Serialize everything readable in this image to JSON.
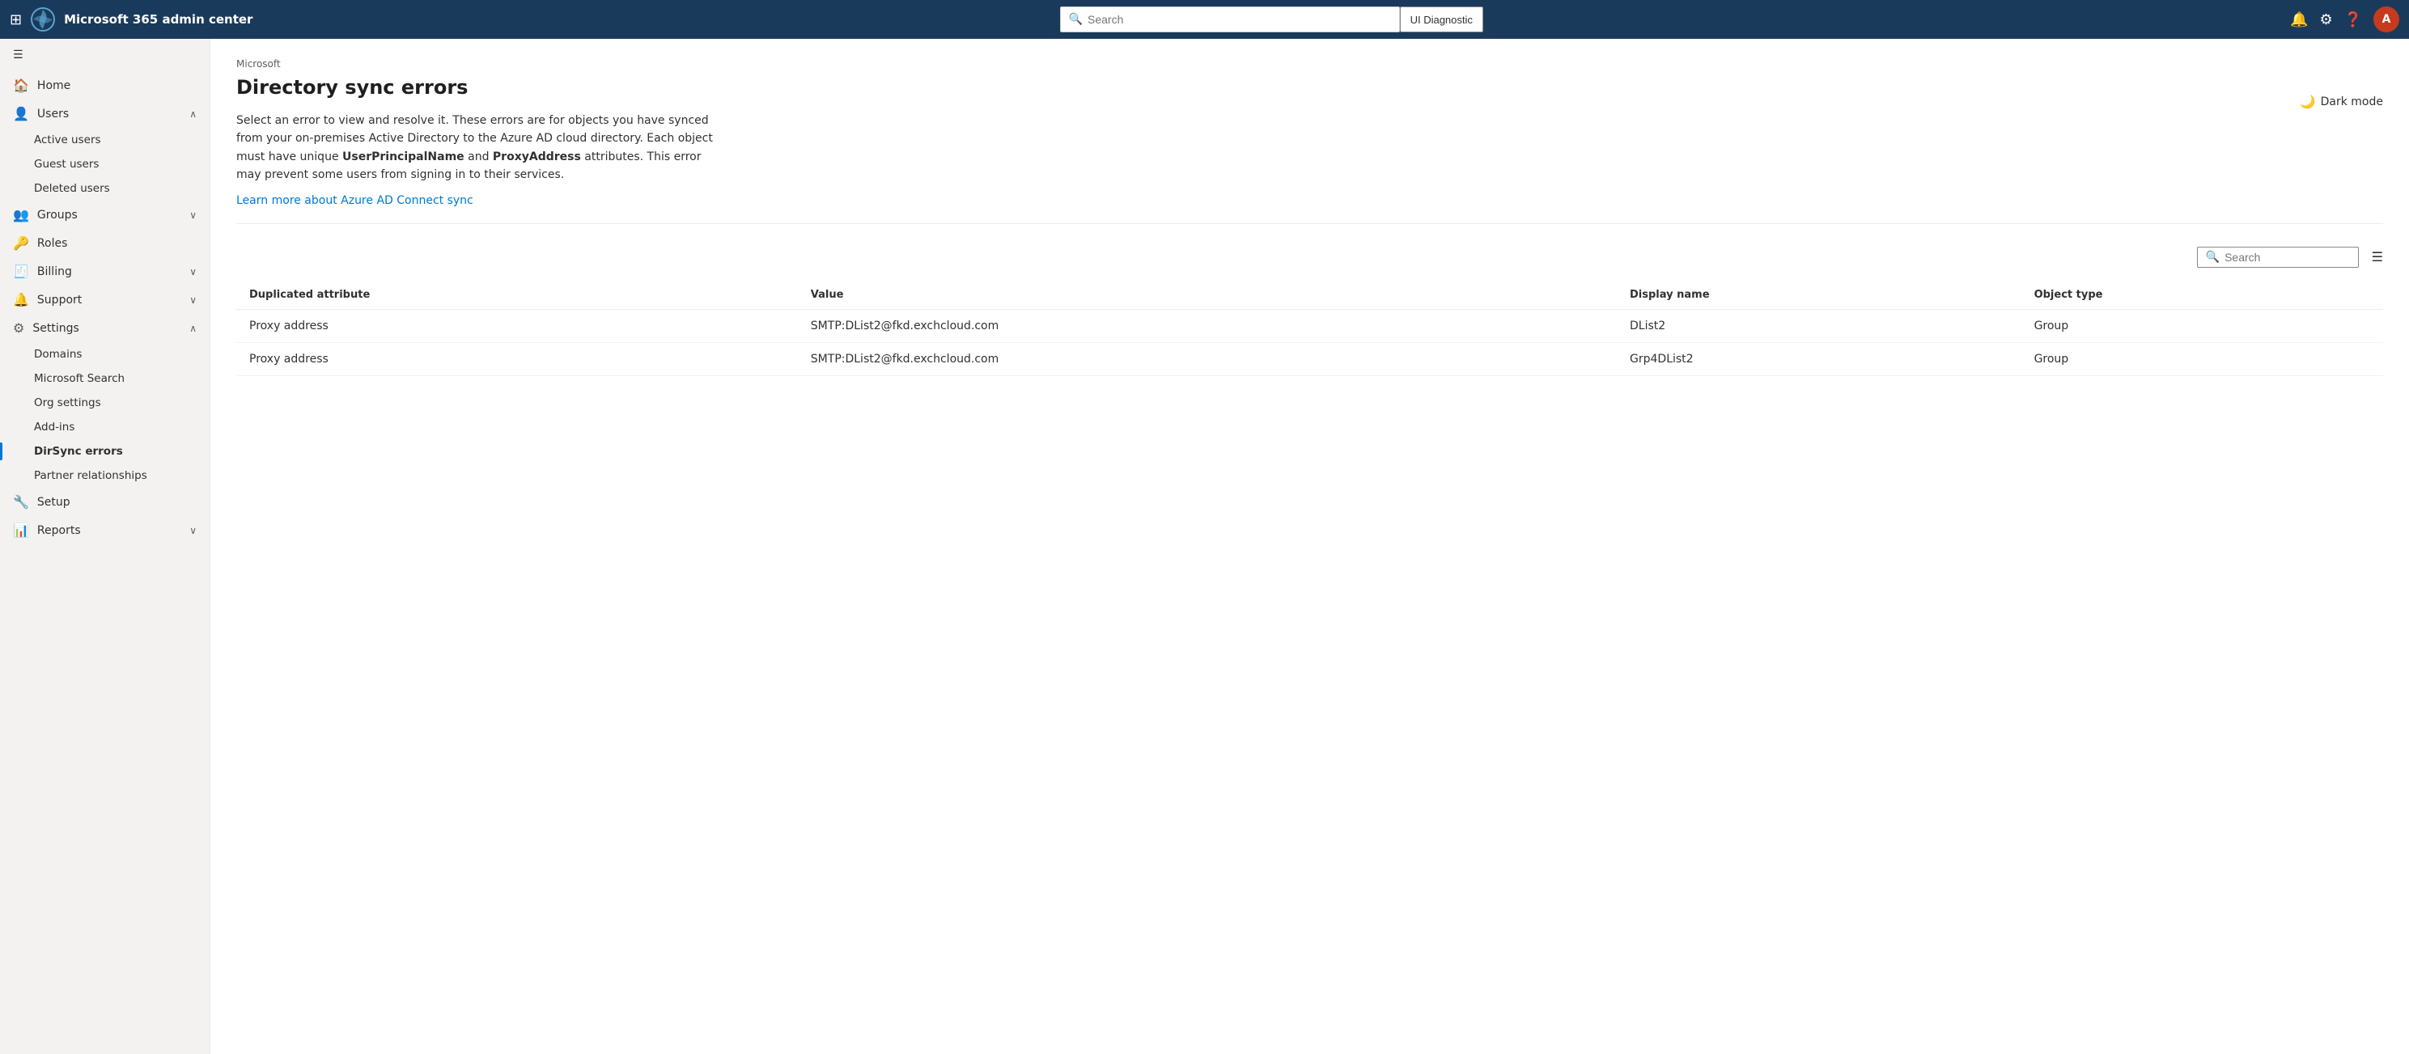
{
  "topbar": {
    "title": "Microsoft 365 admin center",
    "search_placeholder": "Search",
    "ui_diagnostic_label": "UI Diagnostic",
    "avatar_initials": "A"
  },
  "sidebar": {
    "hamburger_label": "",
    "items": [
      {
        "id": "home",
        "label": "Home",
        "icon": "🏠",
        "expandable": false
      },
      {
        "id": "users",
        "label": "Users",
        "icon": "👤",
        "expandable": true,
        "expanded": true
      },
      {
        "id": "groups",
        "label": "Groups",
        "icon": "👥",
        "expandable": true,
        "expanded": false
      },
      {
        "id": "roles",
        "label": "Roles",
        "icon": "🔑",
        "expandable": false
      },
      {
        "id": "billing",
        "label": "Billing",
        "icon": "🧾",
        "expandable": true,
        "expanded": false
      },
      {
        "id": "support",
        "label": "Support",
        "icon": "🔔",
        "expandable": true,
        "expanded": false
      },
      {
        "id": "settings",
        "label": "Settings",
        "icon": "⚙",
        "expandable": true,
        "expanded": true
      },
      {
        "id": "setup",
        "label": "Setup",
        "icon": "🔧",
        "expandable": false
      },
      {
        "id": "reports",
        "label": "Reports",
        "icon": "📊",
        "expandable": true,
        "expanded": false
      }
    ],
    "users_sub": [
      {
        "id": "active-users",
        "label": "Active users"
      },
      {
        "id": "guest-users",
        "label": "Guest users"
      },
      {
        "id": "deleted-users",
        "label": "Deleted users"
      }
    ],
    "settings_sub": [
      {
        "id": "domains",
        "label": "Domains"
      },
      {
        "id": "microsoft-search",
        "label": "Microsoft Search"
      },
      {
        "id": "org-settings",
        "label": "Org settings"
      },
      {
        "id": "add-ins",
        "label": "Add-ins"
      },
      {
        "id": "dirsync-errors",
        "label": "DirSync errors",
        "active": true
      },
      {
        "id": "partner-relationships",
        "label": "Partner relationships"
      }
    ]
  },
  "content": {
    "breadcrumb": "Microsoft",
    "title": "Directory sync errors",
    "description": "Select an error to view and resolve it. These errors are for objects you have synced from your on-premises Active Directory to the Azure AD cloud directory. Each object must have unique ",
    "bold1": "UserPrincipalName",
    "mid_text": " and ",
    "bold2": "ProxyAddress",
    "end_text": " attributes. This error may prevent some users from signing in to their services.",
    "link_text": "Learn more about Azure AD Connect sync",
    "dark_mode_label": "Dark mode"
  },
  "table_toolbar": {
    "search_placeholder": "Search",
    "filter_icon_label": "filter-icon"
  },
  "table": {
    "columns": [
      {
        "id": "duplicated-attribute",
        "label": "Duplicated attribute"
      },
      {
        "id": "value",
        "label": "Value"
      },
      {
        "id": "display-name",
        "label": "Display name"
      },
      {
        "id": "object-type",
        "label": "Object type"
      }
    ],
    "rows": [
      {
        "duplicated_attribute": "Proxy address",
        "value": "SMTP:DList2@fkd.exchcloud.com",
        "display_name": "DList2",
        "object_type": "Group"
      },
      {
        "duplicated_attribute": "Proxy address",
        "value": "SMTP:DList2@fkd.exchcloud.com",
        "display_name": "Grp4DList2",
        "object_type": "Group"
      }
    ]
  }
}
